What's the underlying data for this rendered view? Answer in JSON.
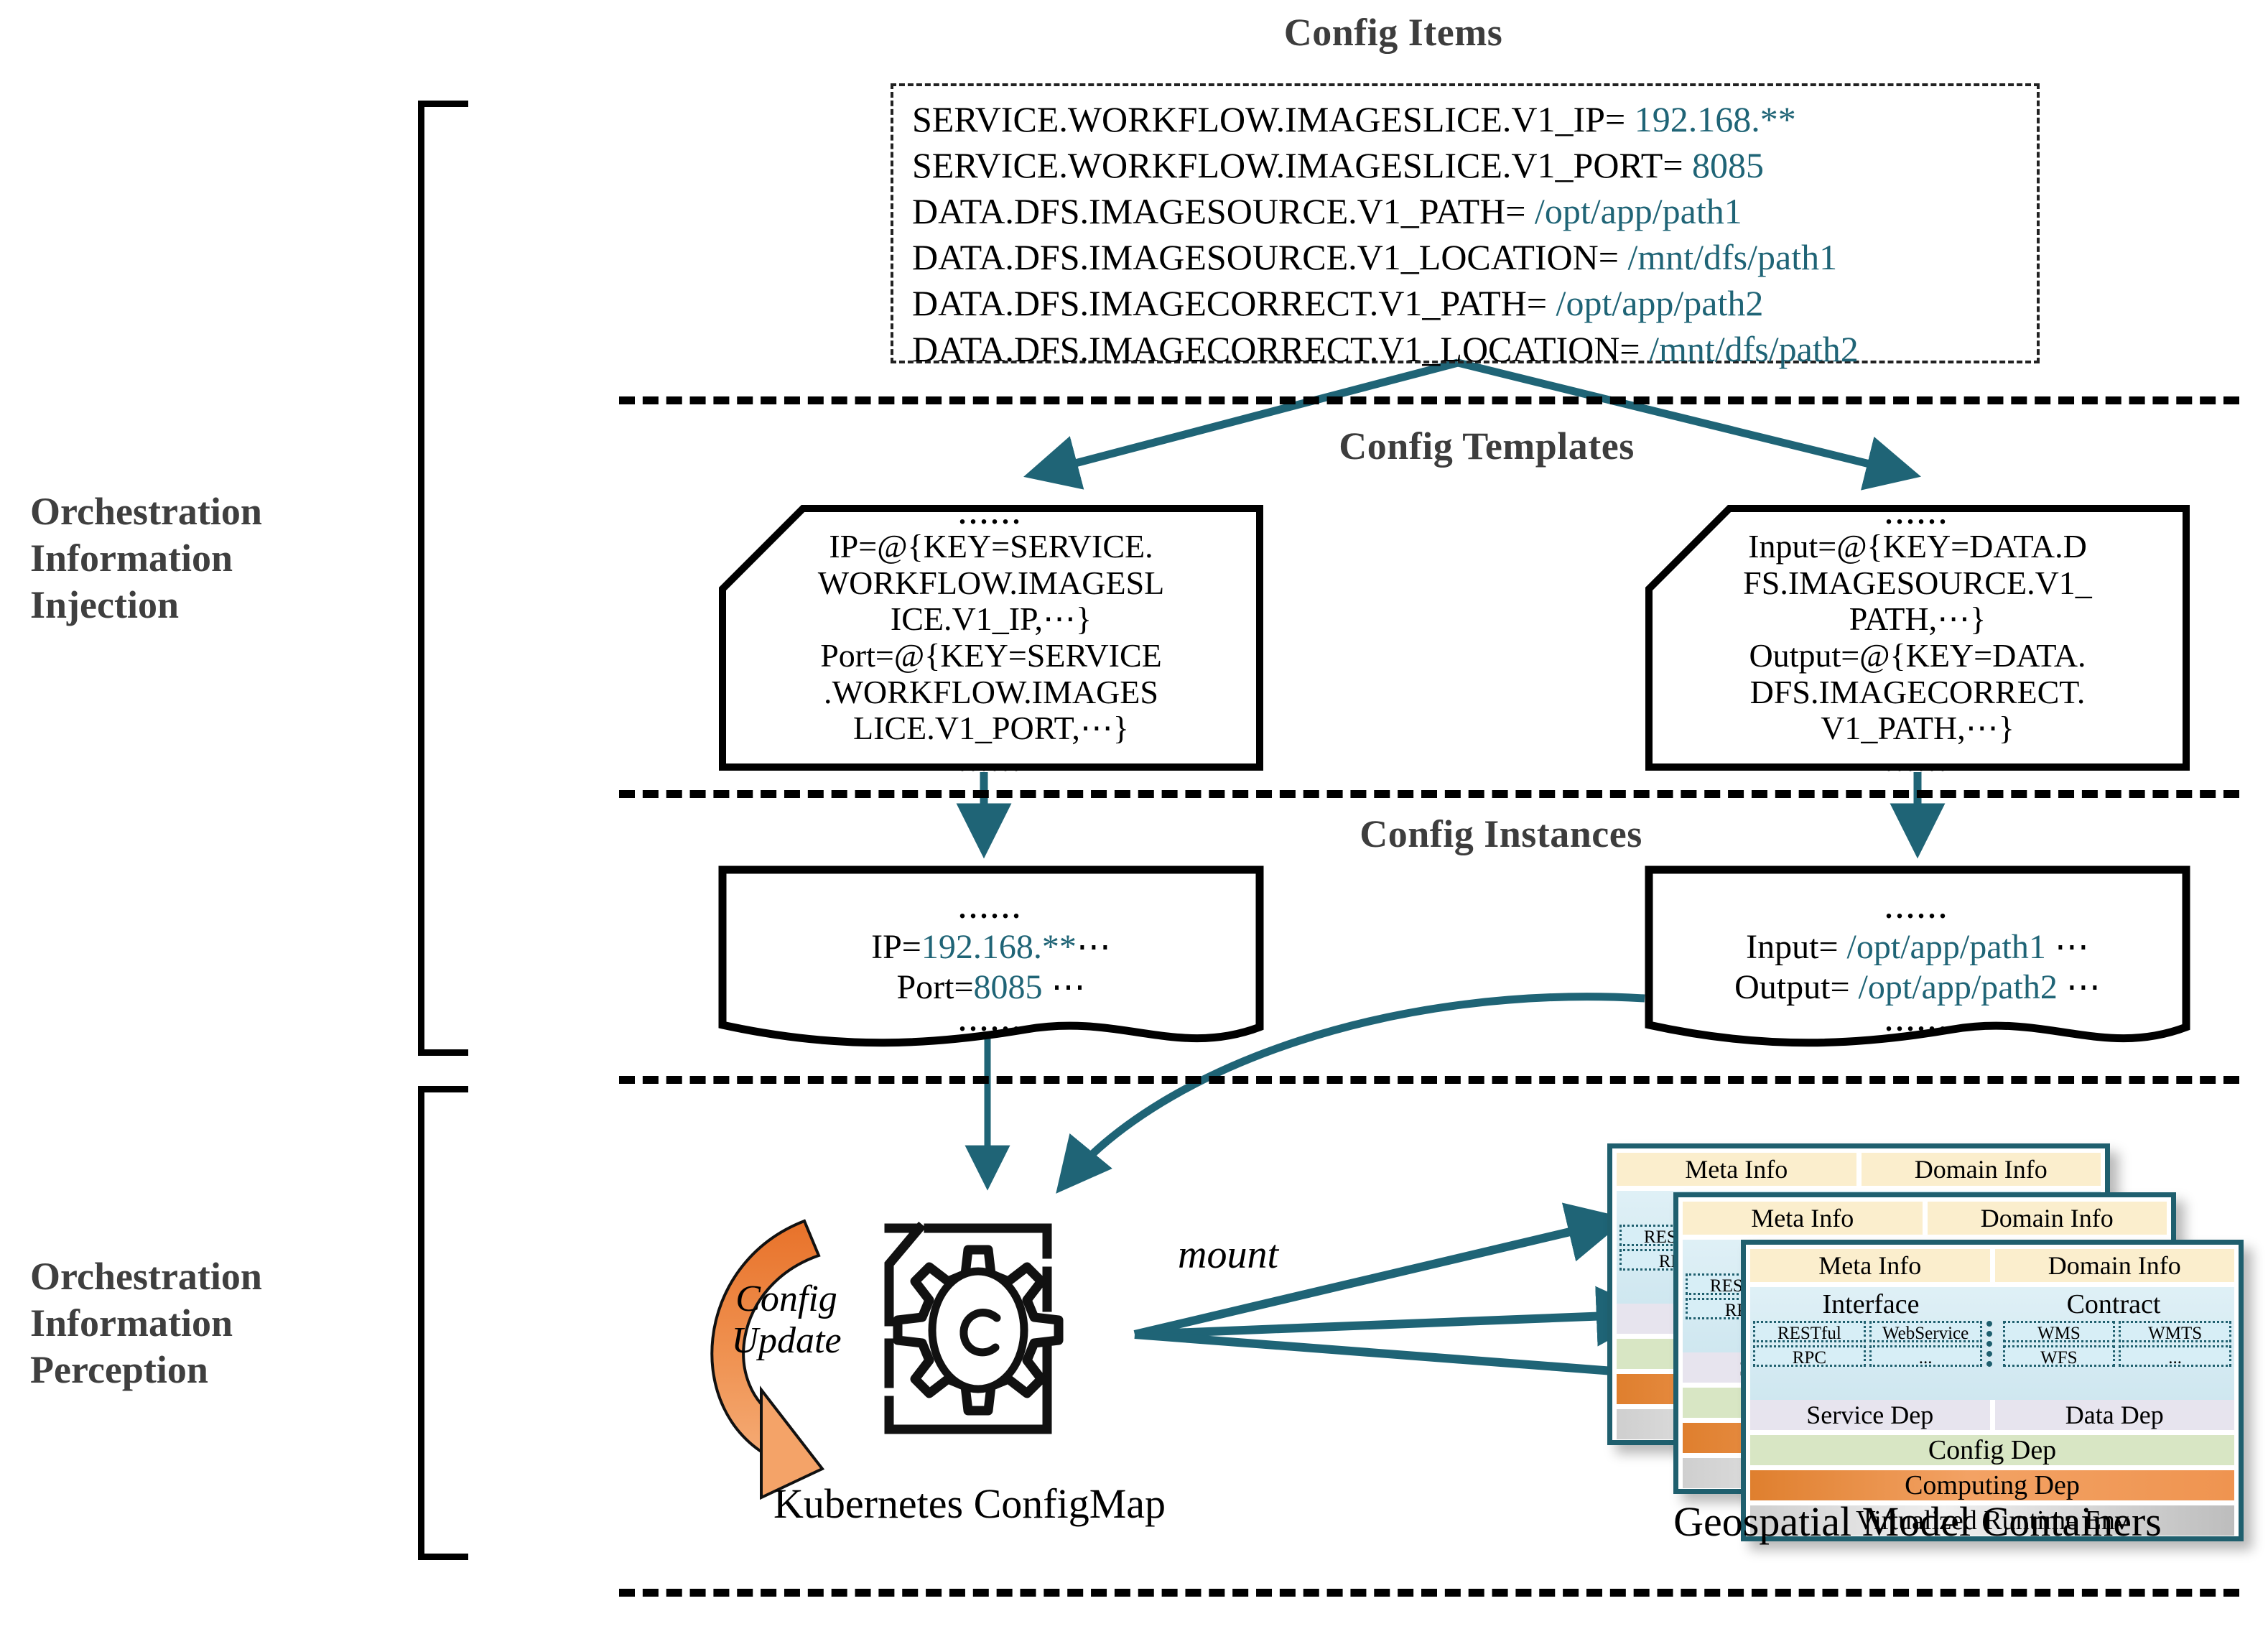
{
  "phases": [
    {
      "label": "Orchestration\nInformation\nInjection"
    },
    {
      "label": "Orchestration\nInformation\nPerception"
    }
  ],
  "sections": {
    "config_items": "Config Items",
    "config_templates": "Config Templates",
    "config_instances": "Config Instances"
  },
  "config_items": [
    {
      "key": "SERVICE.WORKFLOW.IMAGESLICE.V1_IP=",
      "value": "192.168.**"
    },
    {
      "key": "SERVICE.WORKFLOW.IMAGESLICE.V1_PORT=",
      "value": "8085"
    },
    {
      "key": "DATA.DFS.IMAGESOURCE.V1_PATH=",
      "value": "/opt/app/path1"
    },
    {
      "key": "DATA.DFS.IMAGESOURCE.V1_LOCATION=",
      "value": "/mnt/dfs/path1"
    },
    {
      "key": "DATA.DFS.IMAGECORRECT.V1_PATH=",
      "value": "/opt/app/path2"
    },
    {
      "key": "DATA.DFS.IMAGECORRECT.V1_LOCATION=",
      "value": "/mnt/dfs/path2"
    }
  ],
  "ellipsis": "......",
  "config_templates": [
    {
      "name": "service-template",
      "lines": [
        "IP=@{KEY=SERVICE.",
        "WORKFLOW.IMAGESL",
        "ICE.V1_IP,⋯}",
        "Port=@{KEY=SERVICE",
        ".WORKFLOW.IMAGES",
        "LICE.V1_PORT,⋯}"
      ]
    },
    {
      "name": "data-template",
      "lines": [
        "Input=@{KEY=DATA.D",
        "FS.IMAGESOURCE.V1_",
        "PATH,⋯}",
        "Output=@{KEY=DATA.",
        "DFS.IMAGECORRECT.",
        "V1_PATH,⋯}"
      ]
    }
  ],
  "config_instances": [
    {
      "name": "service-instance",
      "entries": [
        {
          "key": "IP=",
          "value": "192.168.**",
          "tail": "⋯"
        },
        {
          "key": "Port=",
          "value": "8085",
          "tail": "⋯"
        }
      ]
    },
    {
      "name": "data-instance",
      "entries": [
        {
          "key": "Input=",
          "value": "/opt/app/path1",
          "tail": "⋯"
        },
        {
          "key": "Output=",
          "value": "/opt/app/path2",
          "tail": "⋯"
        }
      ]
    }
  ],
  "configmap": {
    "caption": "Kubernetes ConfigMap",
    "update_label_line1": "Config",
    "update_label_line2": "Update",
    "mount_label": "mount",
    "icon": "configmap-gear-icon"
  },
  "containers": {
    "caption": "Geospatial Model Containers",
    "rows": {
      "meta_info": "Meta Info",
      "domain_info": "Domain Info",
      "interface": "Interface",
      "contract": "Contract",
      "service_dep": "Service Dep",
      "data_dep": "Data Dep",
      "config_dep": "Config Dep",
      "computing_dep": "Computing Dep",
      "runtime_env": "Virtualized Runtime Env"
    },
    "interface_chips": [
      "RESTful",
      "WebService",
      "RPC",
      "..."
    ],
    "contract_chips": [
      "WMS",
      "WMTS",
      "WFS",
      "..."
    ]
  },
  "colors": {
    "teal": "#1f6476",
    "card_border": "#1f5f6e",
    "orange_dark": "#e07728",
    "orange_light": "#f4a768",
    "value_text": "#1f6476",
    "title_gray": "#3d3d3d"
  }
}
